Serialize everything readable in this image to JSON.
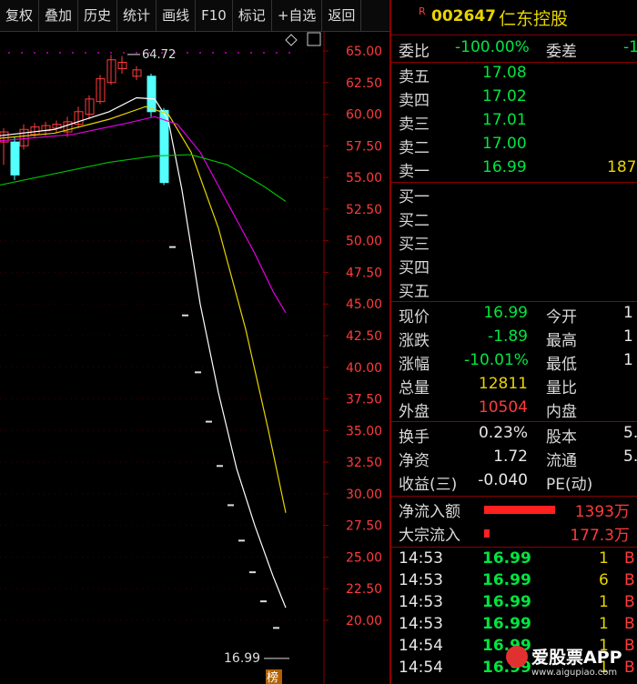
{
  "toolbar": {
    "items": [
      "复权",
      "叠加",
      "历史",
      "统计",
      "画线",
      "F10",
      "标记",
      "+自选",
      "返回"
    ]
  },
  "stock": {
    "badge": "R",
    "code": "002647",
    "name": "仁东控股"
  },
  "chart_data": {
    "type": "candlestick",
    "price_axis": [
      "65.00",
      "62.50",
      "60.00",
      "57.50",
      "55.00",
      "52.50",
      "50.00",
      "47.50",
      "45.00",
      "42.50",
      "40.00",
      "37.50",
      "35.00",
      "32.50",
      "30.00",
      "27.50",
      "25.00",
      "22.50",
      "20.00"
    ],
    "high_label": "64.72",
    "last_label": "16.99",
    "bang_label": "榜"
  },
  "quote": {
    "weibi": {
      "label": "委比",
      "value": "-100.00%"
    },
    "weicha": {
      "label": "委差",
      "value": "-1"
    },
    "asks": [
      {
        "label": "卖五",
        "price": "17.08",
        "vol": ""
      },
      {
        "label": "卖四",
        "price": "17.02",
        "vol": ""
      },
      {
        "label": "卖三",
        "price": "17.01",
        "vol": ""
      },
      {
        "label": "卖二",
        "price": "17.00",
        "vol": ""
      },
      {
        "label": "卖一",
        "price": "16.99",
        "vol": "187"
      }
    ],
    "bids": [
      {
        "label": "买一"
      },
      {
        "label": "买二"
      },
      {
        "label": "买三"
      },
      {
        "label": "买四"
      },
      {
        "label": "买五"
      }
    ],
    "stats": [
      {
        "l1": "现价",
        "v1": "16.99",
        "l2": "今开",
        "v2": "1"
      },
      {
        "l1": "涨跌",
        "v1": "-1.89",
        "l2": "最高",
        "v2": "1"
      },
      {
        "l1": "涨幅",
        "v1": "-10.01%",
        "l2": "最低",
        "v2": "1"
      },
      {
        "l1": "总量",
        "v1": "12811",
        "l2": "量比",
        "v2": ""
      },
      {
        "l1": "外盘",
        "v1": "10504",
        "l2": "内盘",
        "v2": ""
      }
    ],
    "stats2": [
      {
        "l1": "换手",
        "v1": "0.23%",
        "l2": "股本",
        "v2": "5."
      },
      {
        "l1": "净资",
        "v1": "1.72",
        "l2": "流通",
        "v2": "5."
      },
      {
        "l1": "收益(三)",
        "v1": "-0.040",
        "l2": "PE(动)",
        "v2": ""
      }
    ],
    "flow": [
      {
        "label": "净流入额",
        "value": "1393万"
      },
      {
        "label": "大宗流入",
        "value": "177.3万"
      }
    ],
    "ticks": [
      {
        "time": "14:53",
        "price": "16.99",
        "vol": "1",
        "side": "B"
      },
      {
        "time": "14:53",
        "price": "16.99",
        "vol": "6",
        "side": "B"
      },
      {
        "time": "14:53",
        "price": "16.99",
        "vol": "1",
        "side": "B"
      },
      {
        "time": "14:53",
        "price": "16.99",
        "vol": "1",
        "side": "B"
      },
      {
        "time": "14:54",
        "price": "16.99",
        "vol": "1",
        "side": "B"
      },
      {
        "time": "14:54",
        "price": "16.99",
        "vol": "1",
        "side": "B"
      }
    ]
  },
  "watermark": {
    "brand": "爱股票APP",
    "url": "www.aigupiao.com"
  }
}
